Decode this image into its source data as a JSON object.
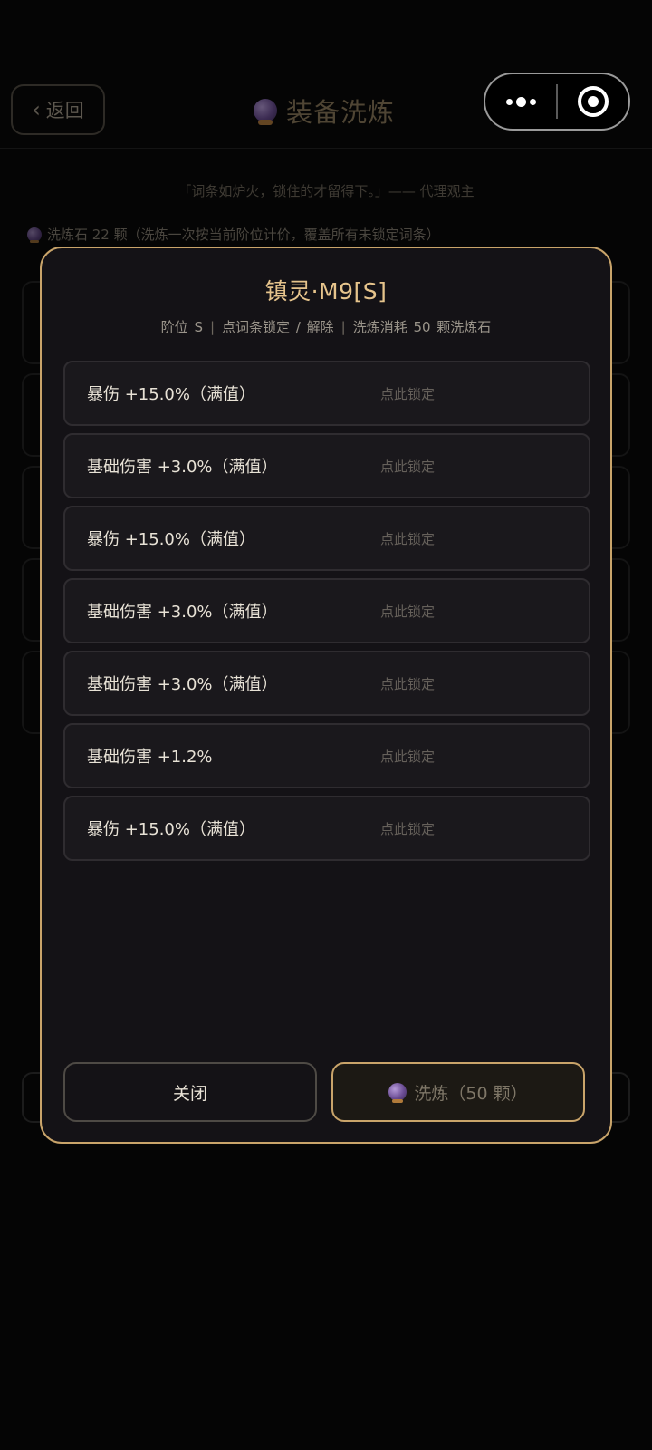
{
  "header": {
    "back_label": "返回",
    "title": "装备洗炼"
  },
  "quote": "「词条如炉火，锁住的才留得下。」—— 代理观主",
  "stone_info": "洗炼石 22 颗（洗炼一次按当前阶位计价，覆盖所有未锁定词条）",
  "modal": {
    "title": "镇灵·M9[S]",
    "subtitle": {
      "tier": "阶位 S",
      "hint": "点词条锁定 / 解除",
      "cost": "洗炼消耗 50 颗洗炼石"
    },
    "attributes": [
      {
        "text": "暴伤 +15.0%（满值）",
        "lock_hint": "点此锁定"
      },
      {
        "text": "基础伤害 +3.0%（满值）",
        "lock_hint": "点此锁定"
      },
      {
        "text": "暴伤 +15.0%（满值）",
        "lock_hint": "点此锁定"
      },
      {
        "text": "基础伤害 +3.0%（满值）",
        "lock_hint": "点此锁定"
      },
      {
        "text": "基础伤害 +3.0%（满值）",
        "lock_hint": "点此锁定"
      },
      {
        "text": "基础伤害 +1.2%",
        "lock_hint": "点此锁定"
      },
      {
        "text": "暴伤 +15.0%（满值）",
        "lock_hint": "点此锁定"
      }
    ],
    "close_label": "关闭",
    "refine_label": "洗炼（50 颗）"
  },
  "colors": {
    "accent_gold": "#c9a46a",
    "title_gold": "#e6c48c",
    "modal_bg": "#141216"
  },
  "icons": {
    "stone": "crystal-orb-icon",
    "back": "chevron-left-icon",
    "menu": "more-dots-icon",
    "close": "target-close-icon"
  }
}
